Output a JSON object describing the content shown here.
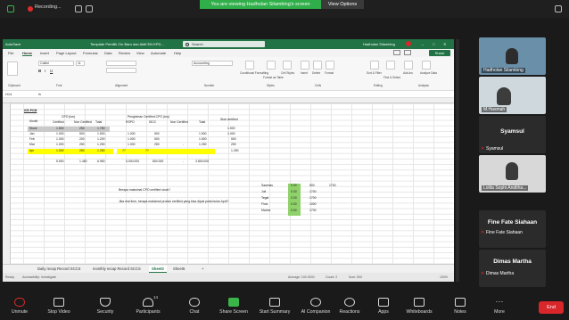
{
  "topbar": {
    "recording_label": "Recording...",
    "viewing_banner": "You are viewing Hadholan Silambing's screen",
    "view_options": "View Options"
  },
  "excel": {
    "title": "Template Pemilik Cin Baru dan Aktif EN KPD...",
    "search_placeholder": "Search",
    "user_name": "Hadholan Silambing",
    "share_label": "Share",
    "menu": [
      "File",
      "Home",
      "Insert",
      "Page Layout",
      "Formulas",
      "Data",
      "Review",
      "View",
      "Automate",
      "Help"
    ],
    "ribbon_groups": [
      "Clipboard",
      "Font",
      "Alignment",
      "Number",
      "Styles",
      "Cells",
      "Editing",
      "Analysis"
    ],
    "ribbon_labels": {
      "font_name": "Calibri",
      "font_size": "11",
      "number_format": "Accounting",
      "conditional": "Conditional Formatting",
      "format_table": "Format as Table",
      "cell_styles": "Cell Styles",
      "insert": "Insert",
      "delete": "Delete",
      "format": "Format",
      "sort": "Sort & Filter",
      "find": "Find & Select",
      "addins": "Add-ins",
      "analyze": "Analyze Data"
    },
    "name_box": "H14",
    "formula": "",
    "sheet": {
      "title": "ICE-PCM",
      "cpo_header": "CPO (ton)",
      "pengiriman_header": "Pengiriman Certified CPO (ton)",
      "stok_header": "Stok certified",
      "col_month": "Month",
      "col_certified": "Certified",
      "col_noncertified": "Non Certified",
      "col_total": "Total",
      "col_rspo": "RSPO",
      "col_iscc": "ISCC",
      "rows": [
        {
          "month": "Stock",
          "cert": "1.500",
          "non": "250",
          "total": "1.750",
          "rspo": "",
          "iscc": "",
          "nc": "",
          "tot2": "",
          "stok": "1.500"
        },
        {
          "month": "Jan",
          "cert": "1.000",
          "non": "500",
          "total": "1.500",
          "rspo": "1.000",
          "iscc": "500",
          "nc": "",
          "tot2": "1.500",
          "stok": "1.000"
        },
        {
          "month": "Feb",
          "cert": "1.000",
          "non": "200",
          "total": "1.200",
          "rspo": "1.000",
          "iscc": "500",
          "nc": "",
          "tot2": "1.500",
          "stok": "500"
        },
        {
          "month": "Mar",
          "cert": "1.000",
          "non": "250",
          "total": "1.250",
          "rspo": "1.000",
          "iscc": "250",
          "nc": "-",
          "tot2": "1.250",
          "stok": "250"
        },
        {
          "month": "Apr",
          "cert": "1.000",
          "non": "250",
          "total": "1.250",
          "rspo": "??",
          "iscc": "??",
          "nc": "",
          "tot2": "",
          "stok": "1.250"
        }
      ],
      "totals": {
        "cert": "5.500",
        "non": "1.450",
        "total": "6.950",
        "rspo": "3.000.000",
        "iscc": "800.000",
        "nc": "-",
        "tot2": "3.800.000"
      },
      "question1": "Berapa maksimal CPO certified stock?",
      "question2": "Jika real time, berapa maksimal produk certified yang bisa dijual pada bulan April?",
      "side_table": [
        {
          "label": "Sawmas",
          "v1": "0.00",
          "v2": "500",
          "v3": "1700"
        },
        {
          "label": "Juli",
          "v1": "0.00",
          "v2": "1700",
          "v3": ""
        },
        {
          "label": "Tegal",
          "v1": "0.00",
          "v2": "1700",
          "v3": ""
        },
        {
          "label": "Flow",
          "v1": "0.00",
          "v2": "1000",
          "v3": ""
        },
        {
          "label": "Marine",
          "v1": "0.00",
          "v2": "1700",
          "v3": ""
        }
      ]
    },
    "tabs": [
      "Daily recap Record SCCS",
      "monthly recap Record SCCS",
      "Sheet3",
      "Sheet5"
    ],
    "active_tab": "Sheet3",
    "status": {
      "left": "Ready",
      "accessibility": "Accessibility: Investigate",
      "average": "Average: 100.0000",
      "count": "Count: 2",
      "sum": "Sum: 500",
      "zoom": "100%"
    }
  },
  "participants": [
    {
      "name": "Hadholan Silambing",
      "type": "video"
    },
    {
      "name": "M.Hasmah",
      "type": "video"
    },
    {
      "name": "Syamsul",
      "type": "name",
      "sub": "Syamsul"
    },
    {
      "name": "Lolita Sophi Anditha...",
      "type": "video"
    },
    {
      "name": "Fine Fate Siahaan",
      "type": "name",
      "sub": "Fine Fate Siahaan"
    },
    {
      "name": "Dimas Martha",
      "type": "name",
      "sub": "Dimas Martha"
    }
  ],
  "toolbar": {
    "items": [
      "Unmute",
      "Stop Video",
      "Security",
      "Participants",
      "Chat",
      "Share Screen",
      "Start Summary",
      "AI Companion",
      "Reactions",
      "Apps",
      "Whiteboards",
      "Notes",
      "More"
    ],
    "participants_count": "14",
    "end": "End"
  },
  "colors": {
    "zoom_green": "#2fae49",
    "excel_green": "#217346",
    "end_red": "#d9262b",
    "share_green": "#3ab54a",
    "highlight_yellow": "#ffff00",
    "cell_green": "#8fd16a"
  }
}
